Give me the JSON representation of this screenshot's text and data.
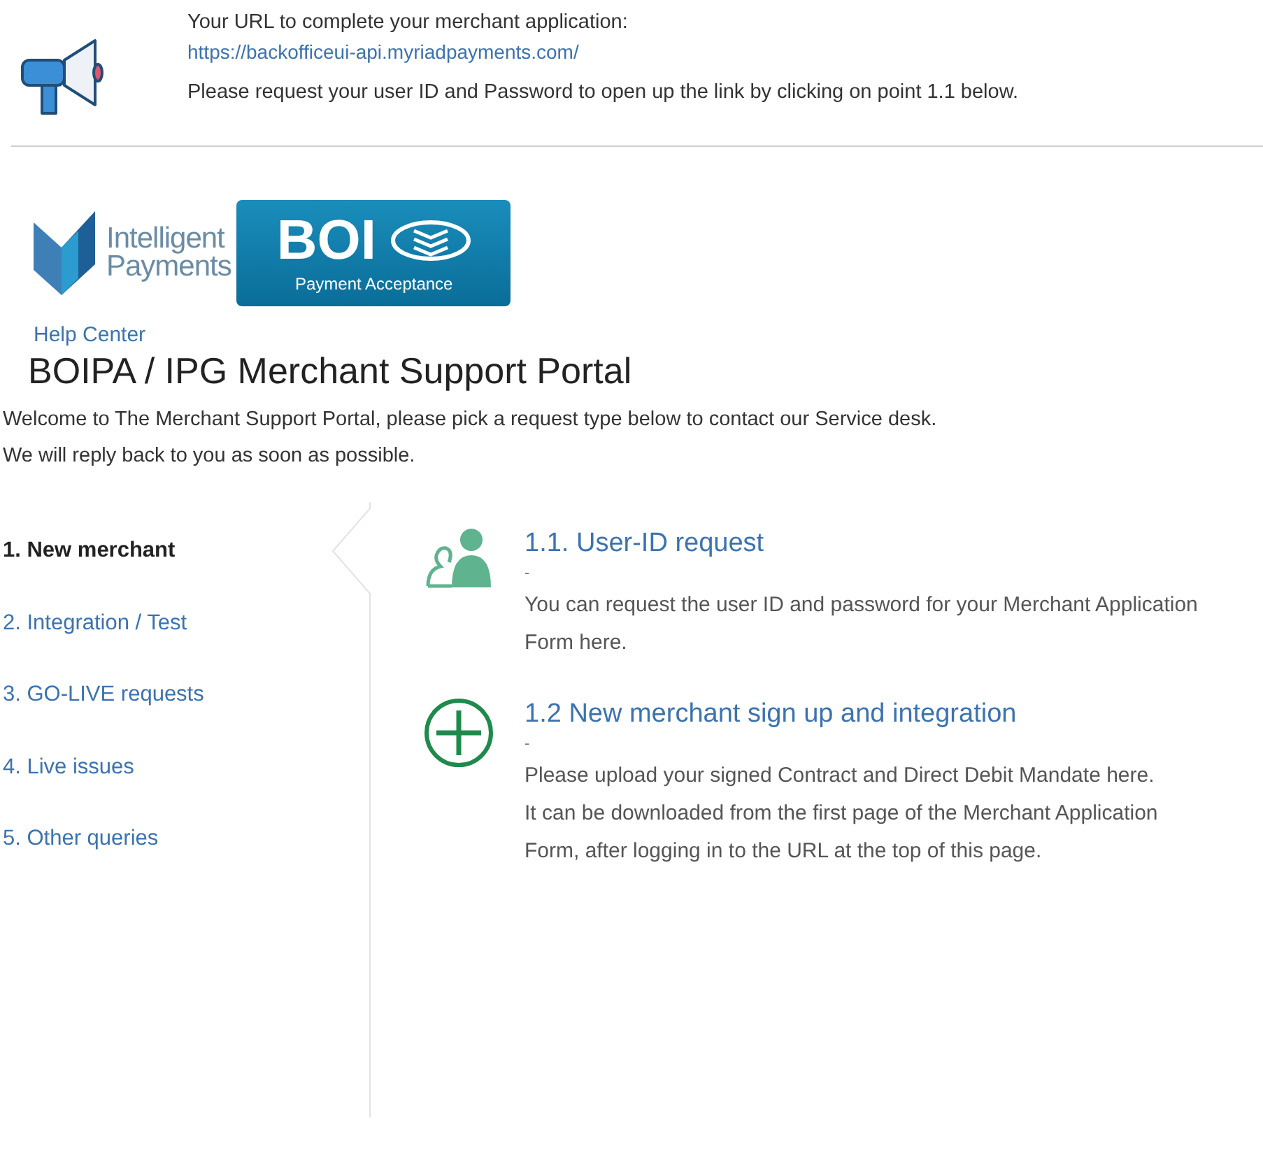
{
  "announcement": {
    "intro": "Your URL to complete your merchant application:",
    "link": "https://backofficeui-api.myriadpayments.com/",
    "note": "Please request your user ID and Password to open up the link by clicking on point 1.1 below."
  },
  "logo": {
    "brand_lines": [
      "Intelligent",
      "Payments"
    ],
    "badge": "BOI",
    "tagline": "Payment Acceptance"
  },
  "breadcrumb": "Help Center",
  "title": "BOIPA / IPG Merchant Support Portal",
  "welcome": [
    "Welcome to The Merchant Support Portal, please pick a request type below to contact our Service desk.",
    "We will reply back to you as soon as possible."
  ],
  "categories": [
    {
      "label": "1. New merchant",
      "selected": true
    },
    {
      "label": "2. Integration / Test",
      "selected": false
    },
    {
      "label": "3. GO-LIVE requests",
      "selected": false
    },
    {
      "label": "4. Live issues",
      "selected": false
    },
    {
      "label": "5. Other queries",
      "selected": false
    }
  ],
  "request_types": [
    {
      "kind": "users",
      "title": "1.1. User-ID request",
      "dash": "-",
      "paragraphs": [
        "You can request the user ID and password for your Merchant Application Form here."
      ]
    },
    {
      "kind": "plus",
      "title": "1.2 New merchant sign up and integration",
      "dash": "-",
      "paragraphs": [
        "Please upload your signed Contract and Direct Debit Mandate here.",
        "It can be downloaded from the first page of the Merchant Application Form, after logging in to the URL at the top of this page."
      ]
    }
  ]
}
